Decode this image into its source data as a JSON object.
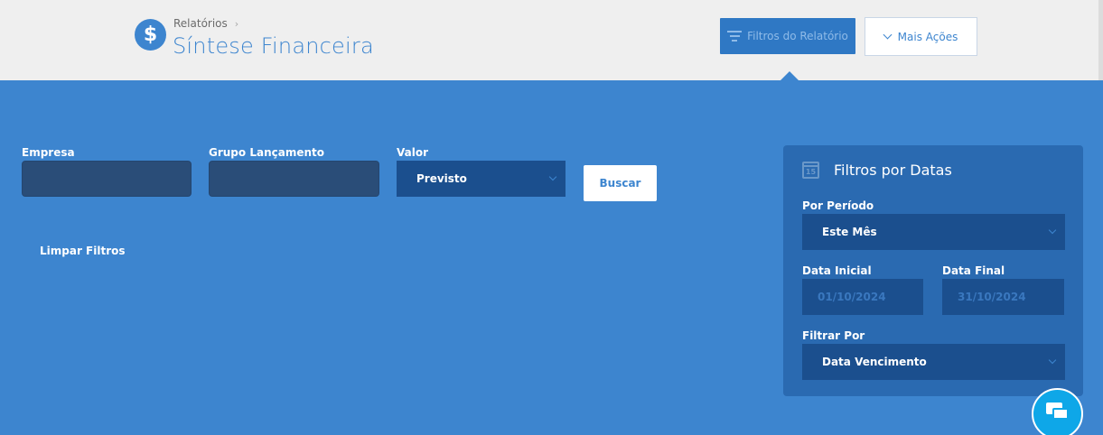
{
  "header": {
    "breadcrumb": "Relatórios",
    "breadcrumb_chevron": "›",
    "title": "Síntese Financeira",
    "title_icon": "dollar-icon",
    "title_icon_glyph": "$",
    "btn_filters": "Filtros do Relatório",
    "btn_more": "Mais Ações"
  },
  "filters": {
    "empresa_label": "Empresa",
    "empresa_value": "",
    "grupo_label": "Grupo Lançamento",
    "grupo_value": "",
    "valor_label": "Valor",
    "valor_value": "Previsto",
    "search_button": "Buscar",
    "clear_link": "Limpar Filtros"
  },
  "date_panel": {
    "title": "Filtros por Datas",
    "calendar_icon_text": "15",
    "period_label": "Por Período",
    "period_value": "Este Mês",
    "start_label": "Data Inicial",
    "start_placeholder": "01/10/2024",
    "end_label": "Data Final",
    "end_placeholder": "31/10/2024",
    "filter_by_label": "Filtrar Por",
    "filter_by_value": "Data Vencimento"
  },
  "colors": {
    "primary": "#3d85cf",
    "header_bg": "#efefef",
    "panel_bg": "#2a6ab1",
    "field_dark": "#1b4f8e",
    "chat": "#0ea7e8"
  }
}
